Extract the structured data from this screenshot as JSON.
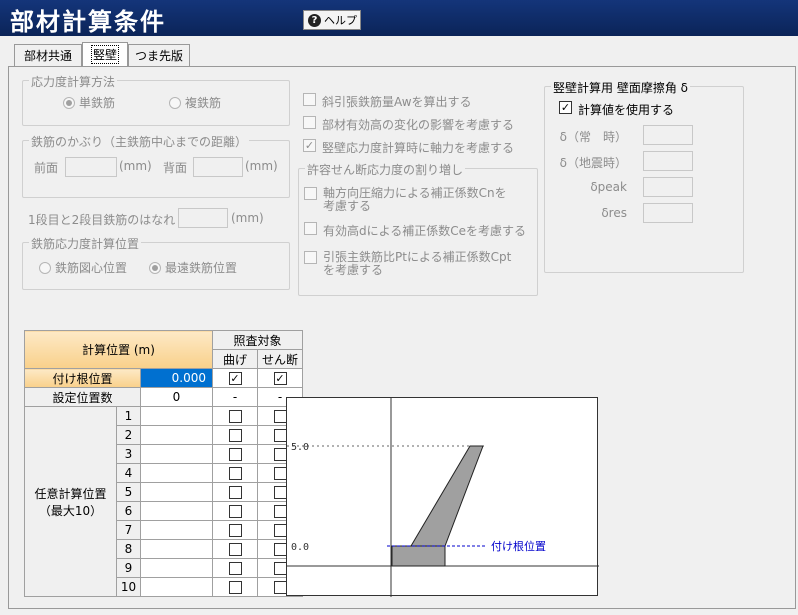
{
  "window": {
    "title": "部材計算条件",
    "help_label": "ヘルプ",
    "help_icon": "question-icon"
  },
  "tabs": [
    {
      "label": "部材共通",
      "active": false
    },
    {
      "label": "竪壁",
      "active": true
    },
    {
      "label": "つま先版",
      "active": false
    }
  ],
  "stress_method": {
    "title": "応力度計算方法",
    "options": [
      {
        "label": "単鉄筋",
        "selected": true
      },
      {
        "label": "複鉄筋",
        "selected": false
      }
    ]
  },
  "cover": {
    "title": "鉄筋のかぶり（主鉄筋中心までの距離）",
    "front_label": "前面",
    "front_value": "",
    "front_unit": "(mm)",
    "back_label": "背面",
    "back_value": "",
    "back_unit": "(mm)"
  },
  "spacing": {
    "label": "1段目と2段目鉄筋のはなれ",
    "value": "",
    "unit": "(mm)"
  },
  "stress_position": {
    "title": "鉄筋応力度計算位置",
    "options": [
      {
        "label": "鉄筋図心位置",
        "selected": false
      },
      {
        "label": "最遠鉄筋位置",
        "selected": true
      }
    ]
  },
  "options": [
    {
      "label": "斜引張鉄筋量Awを算出する",
      "checked": false
    },
    {
      "label": "部材有効高の変化の影響を考慮する",
      "checked": false
    },
    {
      "label": "竪壁応力度計算時に軸力を考慮する",
      "checked": true
    }
  ],
  "shear_increase": {
    "title": "許容せん断応力度の割り増し",
    "options": [
      {
        "line1": "軸方向圧縮力による補正係数Cnを",
        "line2": "考慮する",
        "checked": false
      },
      {
        "line1": "有効高dによる補正係数Ceを考慮する",
        "line2": "",
        "checked": false
      },
      {
        "line1": "引張主鉄筋比Ptによる補正係数Cpt",
        "line2": "を考慮する",
        "checked": false
      }
    ]
  },
  "friction": {
    "title": "竪壁計算用  壁面摩擦角 δ",
    "use_calc_label": "計算値を使用する",
    "use_calc_checked": true,
    "fields": [
      {
        "label": "δ（常　時）",
        "value": ""
      },
      {
        "label": "δ（地震時）",
        "value": ""
      },
      {
        "label": "δpeak",
        "value": ""
      },
      {
        "label": "δres",
        "value": ""
      }
    ]
  },
  "position_table": {
    "calc_pos_header": "計算位置 (m)",
    "target_header": "照査対象",
    "bending_header": "曲げ",
    "shear_header": "せん断",
    "base_label": "付け根位置",
    "base_value": "0.000",
    "base_bending": true,
    "base_shear": true,
    "count_label": "設定位置数",
    "count_value": "0",
    "count_bending": "-",
    "count_shear": "-",
    "arbitrary_label_1": "任意計算位置",
    "arbitrary_label_2": "（最大10）",
    "rows": [
      {
        "no": "1",
        "value": "",
        "bending": false,
        "shear": false
      },
      {
        "no": "2",
        "value": "",
        "bending": false,
        "shear": false
      },
      {
        "no": "3",
        "value": "",
        "bending": false,
        "shear": false
      },
      {
        "no": "4",
        "value": "",
        "bending": false,
        "shear": false
      },
      {
        "no": "5",
        "value": "",
        "bending": false,
        "shear": false
      },
      {
        "no": "6",
        "value": "",
        "bending": false,
        "shear": false
      },
      {
        "no": "7",
        "value": "",
        "bending": false,
        "shear": false
      },
      {
        "no": "8",
        "value": "",
        "bending": false,
        "shear": false
      },
      {
        "no": "9",
        "value": "",
        "bending": false,
        "shear": false
      },
      {
        "no": "10",
        "value": "",
        "bending": false,
        "shear": false
      }
    ]
  },
  "diagram": {
    "tick_top": "5.0",
    "tick_base": "0.0",
    "base_label": "付け根位置",
    "colors": {
      "wall": "#a0a0a0",
      "base_line": "#0000cc",
      "label": "#0000cc"
    }
  }
}
